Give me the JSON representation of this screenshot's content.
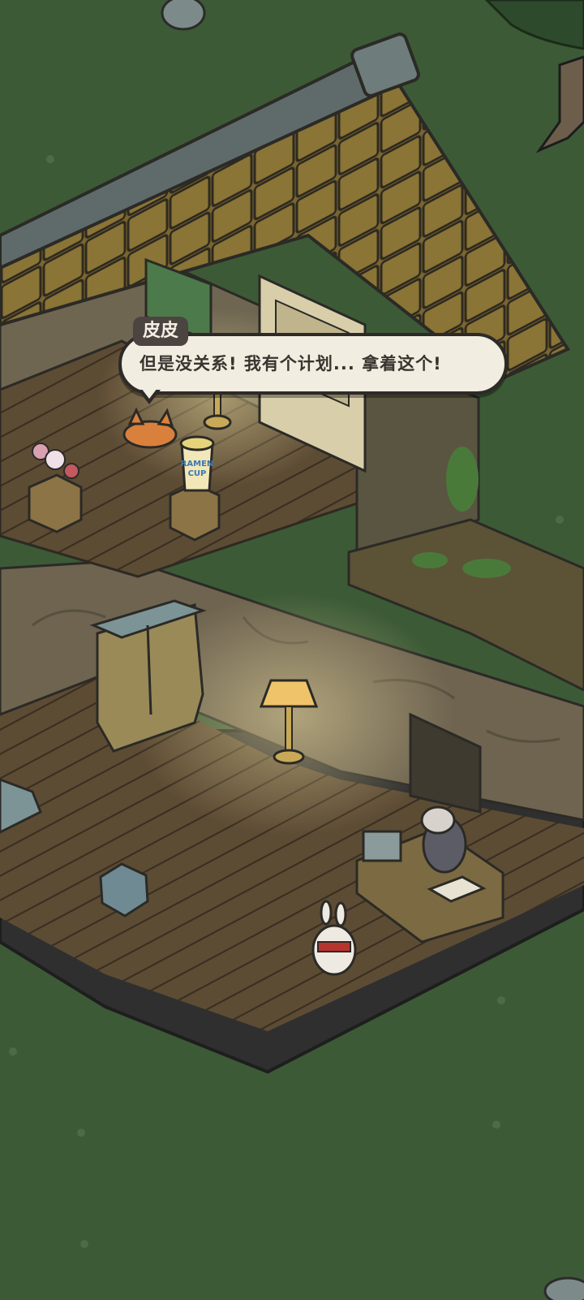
{
  "dialogue": {
    "speaker": "皮皮",
    "text": "但是没关系! 我有个计划... 拿着这个!"
  },
  "props": {
    "ramen_label_1": "RAMEN",
    "ramen_label_2": "CUP"
  },
  "colors": {
    "grass": "#3c5a36",
    "floor": "#5a4a32",
    "wall": "#6e6450",
    "roof": "#7a6530",
    "bubble": "#f1ede0",
    "name_tag": "#4b4440"
  },
  "icons": [
    "fox-icon",
    "rabbit-icon",
    "opossum-icon",
    "lamp-icon",
    "wardrobe-icon",
    "trash-can-icon",
    "cash-register-icon",
    "candy-icon"
  ]
}
